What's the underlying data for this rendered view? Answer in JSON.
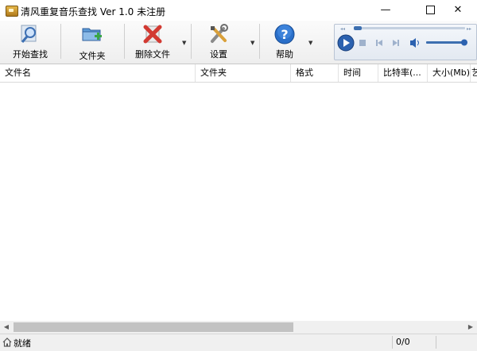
{
  "window": {
    "title": "清风重复音乐查找  Ver 1.0  未注册",
    "minimize_glyph": "—",
    "close_glyph": "✕"
  },
  "toolbar": {
    "start_search_label": "开始查找",
    "folder_label": "文件夹",
    "delete_file_label": "删除文件",
    "settings_label": "设置",
    "help_label": "帮助",
    "dropdown_glyph": "▼"
  },
  "list": {
    "columns": [
      "文件名",
      "文件夹",
      "格式",
      "时间",
      "比特率(...",
      "大小(Mb)",
      "艺"
    ],
    "rows": []
  },
  "status": {
    "text": "就绪",
    "count": "0/0"
  },
  "colors": {
    "accent_blue": "#2a6fc9",
    "delete_red": "#d23a32",
    "folder_green": "#3aa646"
  }
}
